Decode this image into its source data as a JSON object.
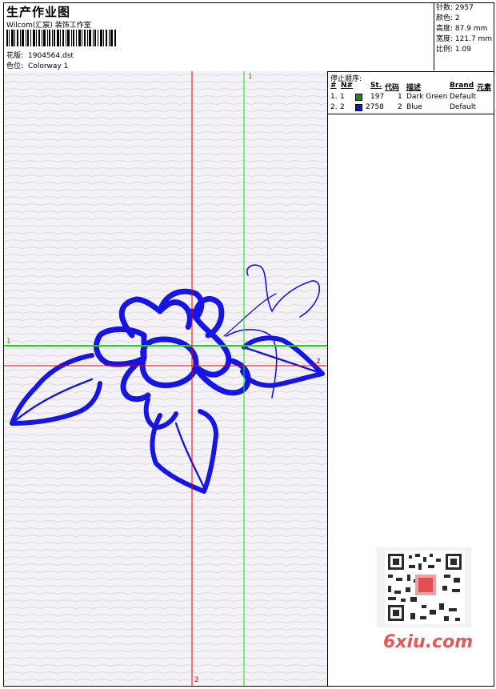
{
  "header": {
    "title": "生产作业图",
    "studio": "Wilcom(汇宸) 装饰工作室",
    "design_label": "花版:",
    "design_value": "1904564.dst",
    "color_label": "色位:",
    "color_value": "Colorway 1"
  },
  "specs": [
    {
      "label": "针数",
      "value": "2957"
    },
    {
      "label": "颜色",
      "value": "2"
    },
    {
      "label": "高度",
      "value": "87.9 mm"
    },
    {
      "label": "宽度",
      "value": "121.7 mm"
    },
    {
      "label": "比例",
      "value": "1.09"
    }
  ],
  "stop_sequence": {
    "title": "停止顺序:",
    "columns": [
      "#",
      "N#",
      "St.",
      "代码",
      "描述",
      "Brand",
      "元素"
    ],
    "rows": [
      {
        "idx": "1.",
        "n": "1",
        "color": "#1a8a1a",
        "st": "197",
        "code": "1",
        "desc": "Dark Green",
        "brand": "Default"
      },
      {
        "idx": "2.",
        "n": "2",
        "color": "#1010e0",
        "st": "2758",
        "code": "2",
        "desc": "Blue",
        "brand": "Default"
      }
    ]
  },
  "axes": {
    "v_green_top": "1",
    "h_green_left": "1",
    "h_red_right": "2",
    "v_red_bottom": "2"
  },
  "colors": {
    "stitch_blue": "#1515e6",
    "guide_green": "#1fd51f",
    "guide_red": "#e60000"
  },
  "watermark": "6xiu.com"
}
